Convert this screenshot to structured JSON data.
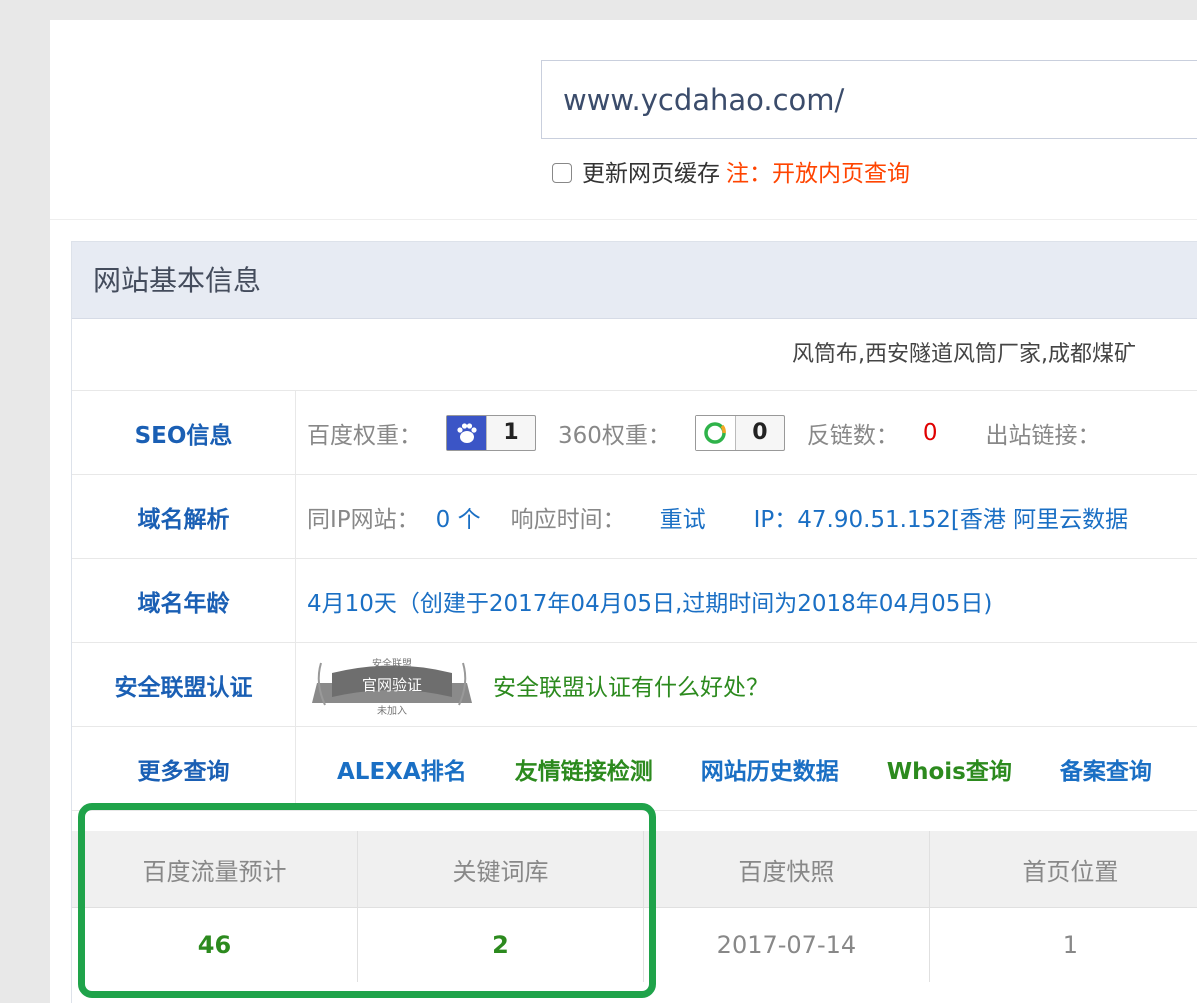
{
  "search": {
    "url_value": "www.ycdahao.com/"
  },
  "cache": {
    "label": "更新网页缓存",
    "note": "注：开放内页查询"
  },
  "panel": {
    "title": "网站基本信息",
    "description": "风筒布,西安隧道风筒厂家,成都煤矿"
  },
  "seo": {
    "label": "SEO信息",
    "baidu_label": "百度权重：",
    "baidu_value": "1",
    "s360_label": "360权重：",
    "s360_value": "0",
    "backlinks_label": "反链数：",
    "backlinks_value": "0",
    "outlinks_label": "出站链接："
  },
  "dns": {
    "label": "域名解析",
    "same_ip_label": "同IP网站：",
    "same_ip_value": "0 个",
    "response_label": "响应时间：",
    "retry": "重试",
    "ip": "IP：47.90.51.152[香港 阿里云数据"
  },
  "age": {
    "label": "域名年龄",
    "value": "4月10天（创建于2017年04月05日,过期时间为2018年04月05日)"
  },
  "security": {
    "label": "安全联盟认证",
    "seal_top": "安全联盟",
    "seal_main": "官网验证",
    "seal_bottom": "未加入",
    "link": "安全联盟认证有什么好处？"
  },
  "more": {
    "label": "更多查询",
    "links": [
      "ALEXA排名",
      "友情链接检测",
      "网站历史数据",
      "Whois查询",
      "备案查询"
    ]
  },
  "stats": {
    "headers": [
      "百度流量预计",
      "关键词库",
      "百度快照",
      "首页位置"
    ],
    "values": [
      "46",
      "2",
      "2017-07-14",
      "1"
    ]
  },
  "colors": {
    "highlight": "#1fa34a",
    "accent_blue": "#1a6fc4",
    "note_red": "#ff4400"
  }
}
